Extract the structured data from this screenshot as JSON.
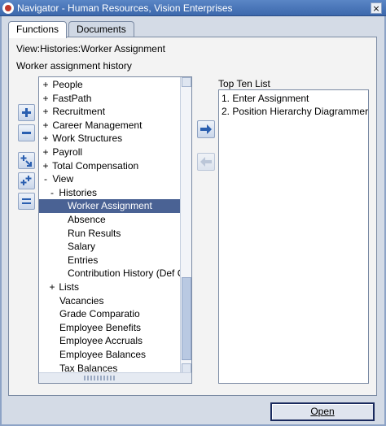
{
  "window": {
    "title": "Navigator - Human Resources, Vision Enterprises",
    "close_glyph": "×"
  },
  "tabs": [
    {
      "label": "Functions"
    },
    {
      "label": "Documents"
    }
  ],
  "view_label": "View:Histories:Worker Assignment",
  "history_label": "Worker assignment history",
  "tree": [
    {
      "expander": "+",
      "label": "People"
    },
    {
      "expander": "+",
      "label": "FastPath"
    },
    {
      "expander": "+",
      "label": "Recruitment"
    },
    {
      "expander": "+",
      "label": "Career Management"
    },
    {
      "expander": "+",
      "label": "Work Structures"
    },
    {
      "expander": "+",
      "label": "Payroll"
    },
    {
      "expander": "+",
      "label": "Total Compensation"
    },
    {
      "expander": "-",
      "label": "View"
    },
    {
      "expander": "-",
      "label": "Histories"
    },
    {
      "expander": "",
      "label": "Worker Assignment"
    },
    {
      "expander": "",
      "label": "Absence"
    },
    {
      "expander": "",
      "label": "Run Results"
    },
    {
      "expander": "",
      "label": "Salary"
    },
    {
      "expander": "",
      "label": "Entries"
    },
    {
      "expander": "",
      "label": "Contribution History (Def Con"
    },
    {
      "expander": "+",
      "label": "Lists"
    },
    {
      "expander": "",
      "label": "Vacancies"
    },
    {
      "expander": "",
      "label": "Grade Comparatio"
    },
    {
      "expander": "",
      "label": "Employee Benefits"
    },
    {
      "expander": "",
      "label": "Employee Accruals"
    },
    {
      "expander": "",
      "label": "Employee Balances"
    },
    {
      "expander": "",
      "label": "Tax Balances"
    }
  ],
  "selected_tree_item": "Worker Assignment",
  "top_ten": {
    "label": "Top Ten List",
    "items": [
      "1. Enter Assignment",
      "2. Position Hierarchy Diagrammer"
    ]
  },
  "buttons": {
    "open": "Open"
  },
  "icons": {
    "expand": "plus-icon",
    "collapse": "minus-icon",
    "expand_branch": "expand-branch-icon",
    "expand_all": "expand-all-icon",
    "collapse_all": "collapse-all-icon",
    "add_to_list": "arrow-right-icon",
    "remove_from_list": "arrow-left-icon"
  },
  "colors": {
    "selection": "#4a6294",
    "titlebar": "#3c68ac",
    "accent": "#2a5fb0"
  }
}
